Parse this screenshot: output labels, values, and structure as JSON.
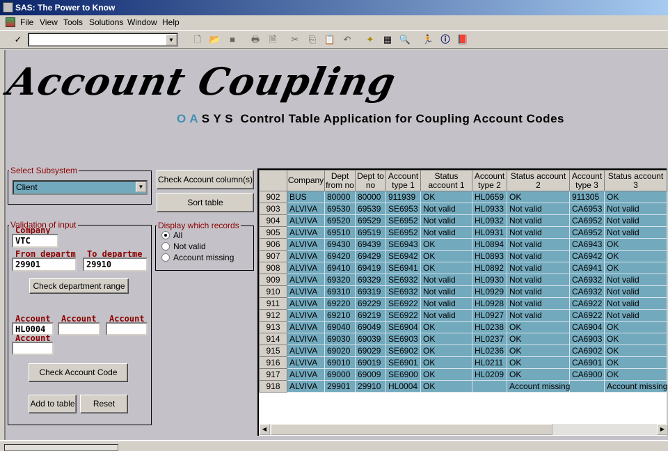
{
  "window": {
    "title": "SAS: The Power to Know"
  },
  "menu": [
    "File",
    "View",
    "Tools",
    "Solutions",
    "Window",
    "Help"
  ],
  "toolbar": {
    "command_value": "",
    "icons": [
      "check-icon",
      "new-icon",
      "open-icon",
      "save-icon",
      "print-icon",
      "print-preview-icon",
      "cut-icon",
      "copy-icon",
      "paste-icon",
      "undo-icon",
      "explorer-icon",
      "results-icon",
      "find-icon",
      "run-icon",
      "help-icon",
      "book-icon"
    ]
  },
  "header": {
    "logo": "Account Coupling",
    "oasys_blue": "O A",
    "oasys_rest": "S Y S",
    "subtitle": "Control Table Application for Coupling Account Codes",
    "accent": "#3f8fb5"
  },
  "subsystem": {
    "legend": "Select Subsystem",
    "value": "Client"
  },
  "buttons": {
    "check_columns": "Check Account column(s)",
    "sort": "Sort table",
    "check_range": "Check department range",
    "check_code": "Check Account Code",
    "add": "Add to table",
    "reset": "Reset"
  },
  "display": {
    "legend": "Display which records",
    "options": [
      "All",
      "Not valid",
      "Account missing"
    ],
    "selected": "All"
  },
  "validation": {
    "legend": "Validation of input",
    "company_label": "Company",
    "company": "VTC",
    "from_label": "From departm",
    "from": "29901",
    "to_label": "To departme",
    "to": "29910",
    "account_label": "Account",
    "account1": "HL0004",
    "account2": "",
    "account3": "",
    "account4": ""
  },
  "table": {
    "columns": [
      "",
      "Company",
      "Dept from no",
      "Dept to no",
      "Account type 1",
      "Status account 1",
      "Account type 2",
      "Status account 2",
      "Account type 3",
      "Status account 3"
    ],
    "rows": [
      [
        "902",
        "BUS",
        "80000",
        "80000",
        "911939",
        "OK",
        "HL0659",
        "OK",
        "911305",
        "OK"
      ],
      [
        "903",
        "ALVIVA",
        "69530",
        "69539",
        "SE6953",
        "Not valid",
        "HL0933",
        "Not valid",
        "CA6953",
        "Not valid"
      ],
      [
        "904",
        "ALVIVA",
        "69520",
        "69529",
        "SE6952",
        "Not valid",
        "HL0932",
        "Not valid",
        "CA6952",
        "Not valid"
      ],
      [
        "905",
        "ALVIVA",
        "69510",
        "69519",
        "SE6952",
        "Not valid",
        "HL0931",
        "Not valid",
        "CA6952",
        "Not valid"
      ],
      [
        "906",
        "ALVIVA",
        "69430",
        "69439",
        "SE6943",
        "OK",
        "HL0894",
        "Not valid",
        "CA6943",
        "OK"
      ],
      [
        "907",
        "ALVIVA",
        "69420",
        "69429",
        "SE6942",
        "OK",
        "HL0893",
        "Not valid",
        "CA6942",
        "OK"
      ],
      [
        "908",
        "ALVIVA",
        "69410",
        "69419",
        "SE6941",
        "OK",
        "HL0892",
        "Not valid",
        "CA6941",
        "OK"
      ],
      [
        "909",
        "ALVIVA",
        "69320",
        "69329",
        "SE6932",
        "Not valid",
        "HL0930",
        "Not valid",
        "CA6932",
        "Not valid"
      ],
      [
        "910",
        "ALVIVA",
        "69310",
        "69319",
        "SE6932",
        "Not valid",
        "HL0929",
        "Not valid",
        "CA6932",
        "Not valid"
      ],
      [
        "911",
        "ALVIVA",
        "69220",
        "69229",
        "SE6922",
        "Not valid",
        "HL0928",
        "Not valid",
        "CA6922",
        "Not valid"
      ],
      [
        "912",
        "ALVIVA",
        "69210",
        "69219",
        "SE6922",
        "Not valid",
        "HL0927",
        "Not valid",
        "CA6922",
        "Not valid"
      ],
      [
        "913",
        "ALVIVA",
        "69040",
        "69049",
        "SE6904",
        "OK",
        "HL0238",
        "OK",
        "CA6904",
        "OK"
      ],
      [
        "914",
        "ALVIVA",
        "69030",
        "69039",
        "SE6903",
        "OK",
        "HL0237",
        "OK",
        "CA6903",
        "OK"
      ],
      [
        "915",
        "ALVIVA",
        "69020",
        "69029",
        "SE6902",
        "OK",
        "HL0236",
        "OK",
        "CA6902",
        "OK"
      ],
      [
        "916",
        "ALVIVA",
        "69010",
        "69019",
        "SE6901",
        "OK",
        "HL0211",
        "OK",
        "CA6901",
        "OK"
      ],
      [
        "917",
        "ALVIVA",
        "69000",
        "69009",
        "SE6900",
        "OK",
        "HL0209",
        "OK",
        "CA6900",
        "OK"
      ],
      [
        "918",
        "ALVIVA",
        "29901",
        "29910",
        "HL0004",
        "OK",
        "",
        "Account missing",
        "",
        "Account missing"
      ]
    ],
    "row_color": "#72a9bd"
  }
}
